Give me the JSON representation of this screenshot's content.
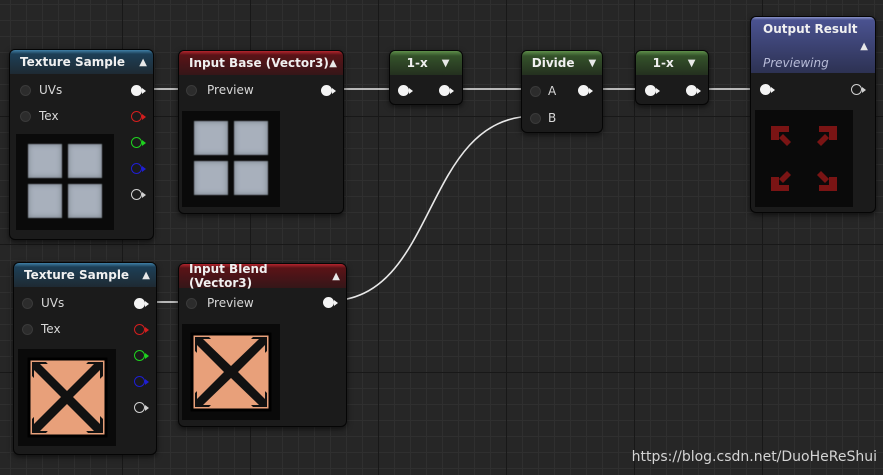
{
  "graph": {
    "texture_sample_top": {
      "title": "Texture Sample",
      "inputs": [
        "UVs",
        "Tex"
      ]
    },
    "input_base": {
      "title": "Input Base (Vector3)",
      "input": "Preview"
    },
    "one_minus_1": {
      "title": "1-x"
    },
    "divide": {
      "title": "Divide",
      "inputs": [
        "A",
        "B"
      ]
    },
    "one_minus_2": {
      "title": "1-x"
    },
    "output_result": {
      "title": "Output Result",
      "subtitle": "Previewing"
    },
    "texture_sample_bottom": {
      "title": "Texture Sample",
      "inputs": [
        "UVs",
        "Tex"
      ]
    },
    "input_blend": {
      "title": "Input Blend (Vector3)",
      "input": "Preview"
    }
  },
  "icons": {
    "collapse": "triangle-up-icon",
    "dropdown": "triangle-down-icon"
  },
  "colors": {
    "pin_r": "#d21e1e",
    "pin_g": "#1ed21e",
    "pin_b": "#1e1ed2",
    "blend_preview": "#e8a07a",
    "result_preview": "#7a1414"
  },
  "watermark": "https://blog.csdn.net/DuoHeReShui"
}
